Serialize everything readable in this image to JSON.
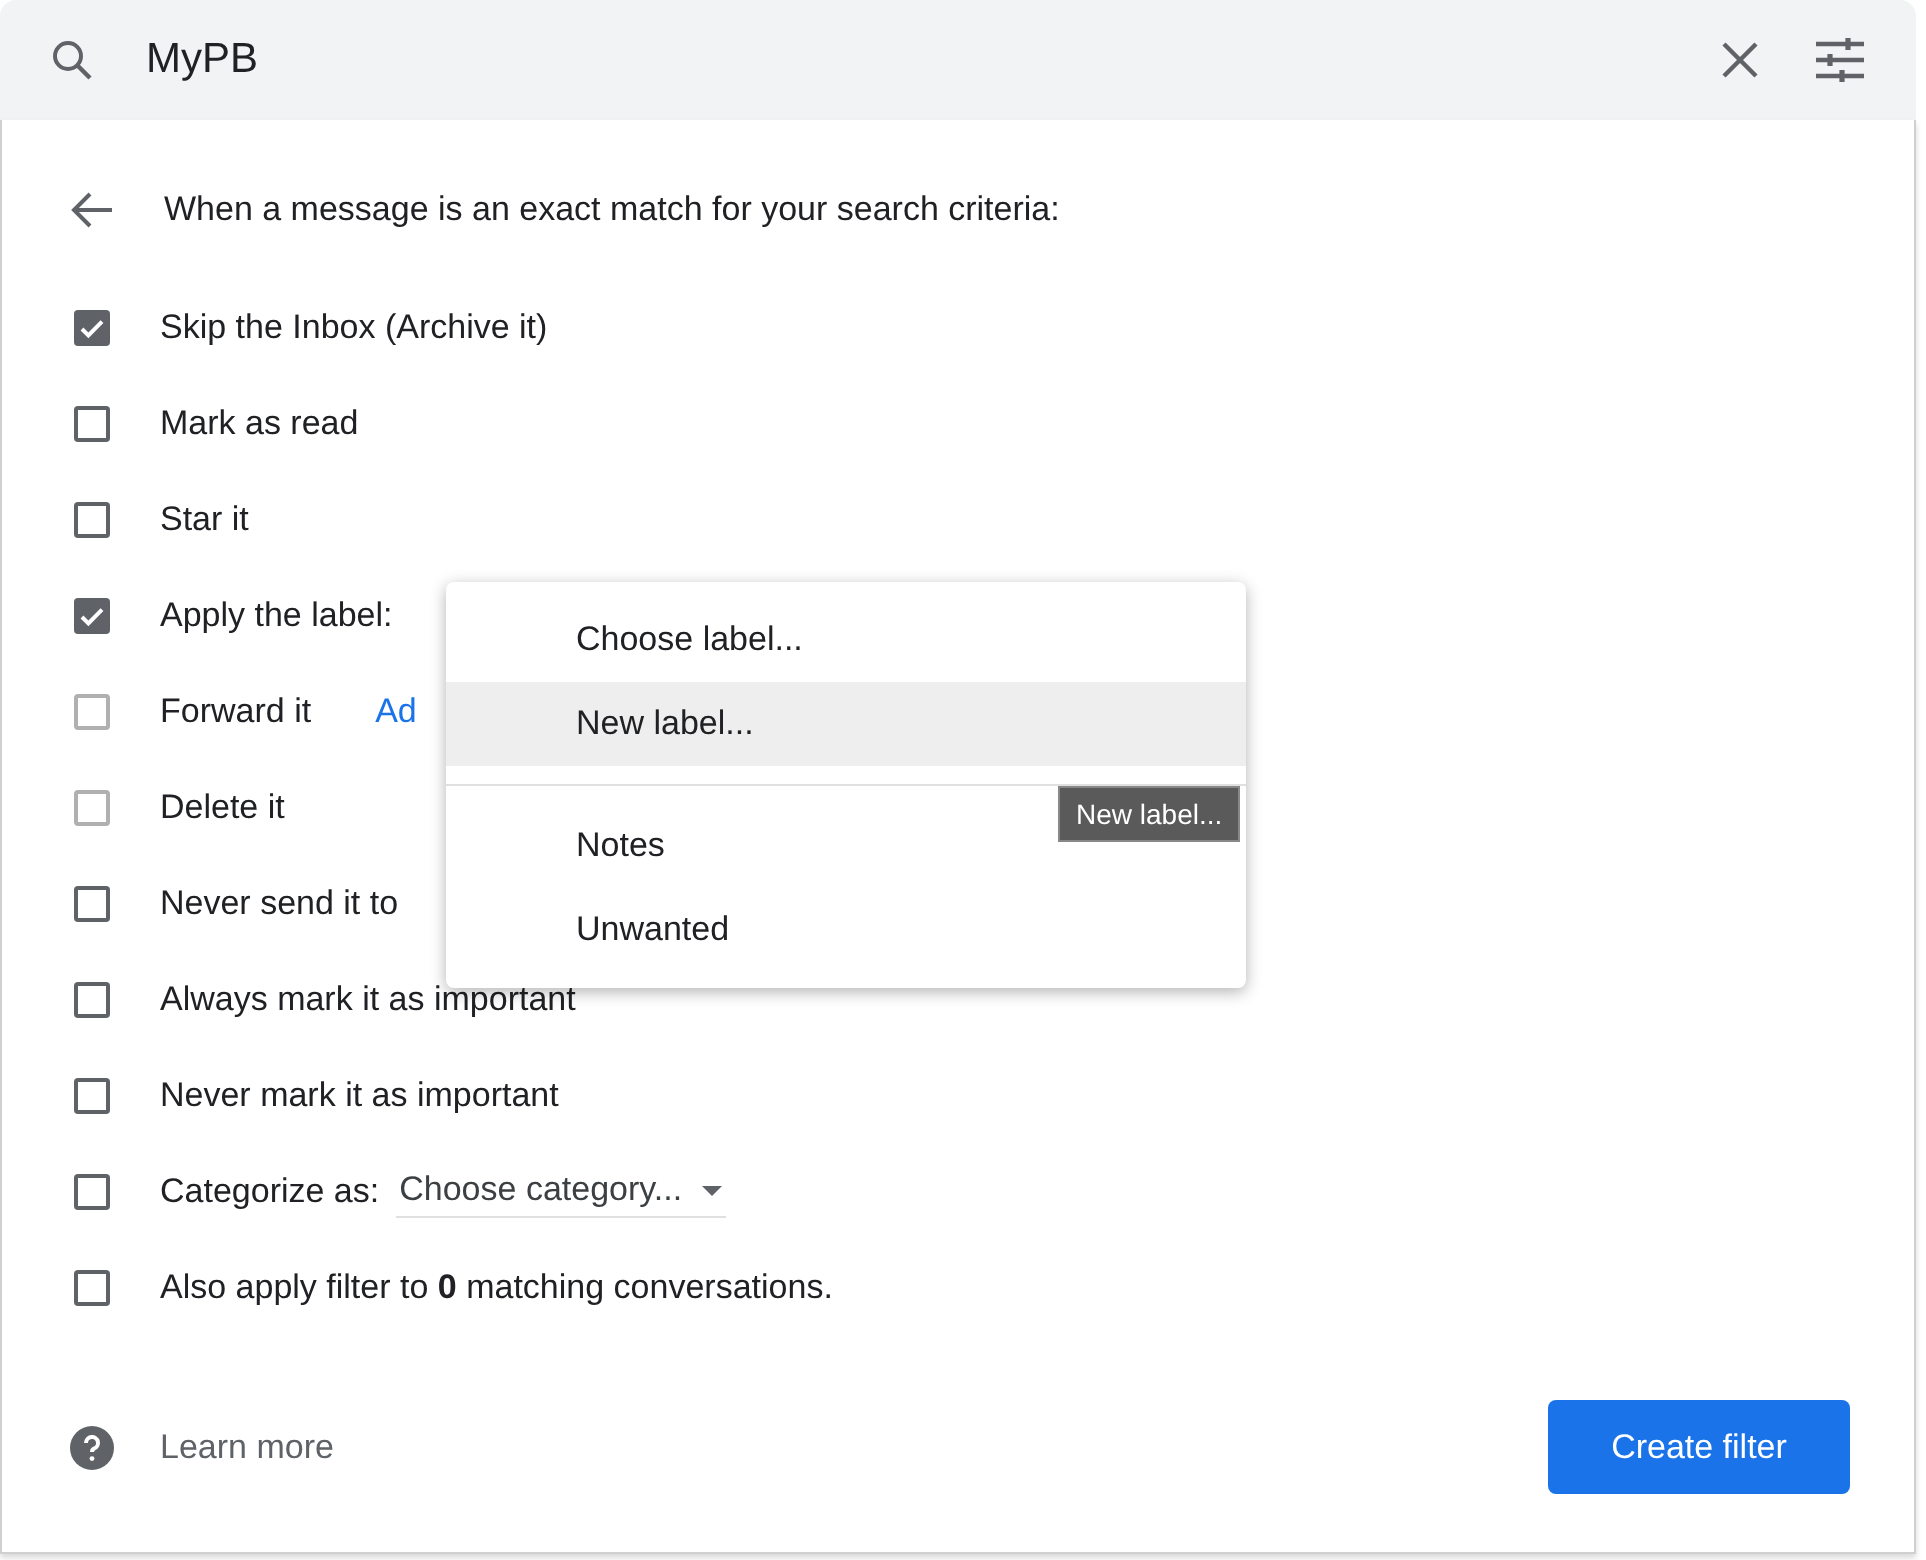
{
  "search": {
    "value": "MyPB"
  },
  "header": "When a message is an exact match for your search criteria:",
  "options": [
    {
      "label": "Skip the Inbox (Archive it)",
      "checked": true,
      "disabled": false
    },
    {
      "label": "Mark as read",
      "checked": false,
      "disabled": false
    },
    {
      "label": "Star it",
      "checked": false,
      "disabled": false
    },
    {
      "label": "Apply the label:",
      "checked": true,
      "disabled": false
    },
    {
      "label": "Forward it",
      "checked": false,
      "disabled": true,
      "link": "Ad"
    },
    {
      "label": "Delete it",
      "checked": false,
      "disabled": true
    },
    {
      "label": "Never send it to",
      "checked": false,
      "disabled": false
    },
    {
      "label": "Always mark it as important",
      "checked": false,
      "disabled": false
    },
    {
      "label": "Never mark it as important",
      "checked": false,
      "disabled": false
    },
    {
      "label": "Categorize as:",
      "checked": false,
      "disabled": false,
      "select": "Choose category..."
    },
    {
      "label": "Also apply filter to **0** matching conversations.",
      "checked": false,
      "disabled": false
    }
  ],
  "menu": {
    "groups": [
      [
        {
          "label": "Choose label...",
          "selected": false
        },
        {
          "label": "New label...",
          "selected": true
        }
      ],
      [
        {
          "label": "Notes",
          "selected": false
        },
        {
          "label": "Unwanted",
          "selected": false
        }
      ]
    ]
  },
  "tooltip": "New label...",
  "footer": {
    "learn_more": "Learn more",
    "button": "Create filter"
  }
}
